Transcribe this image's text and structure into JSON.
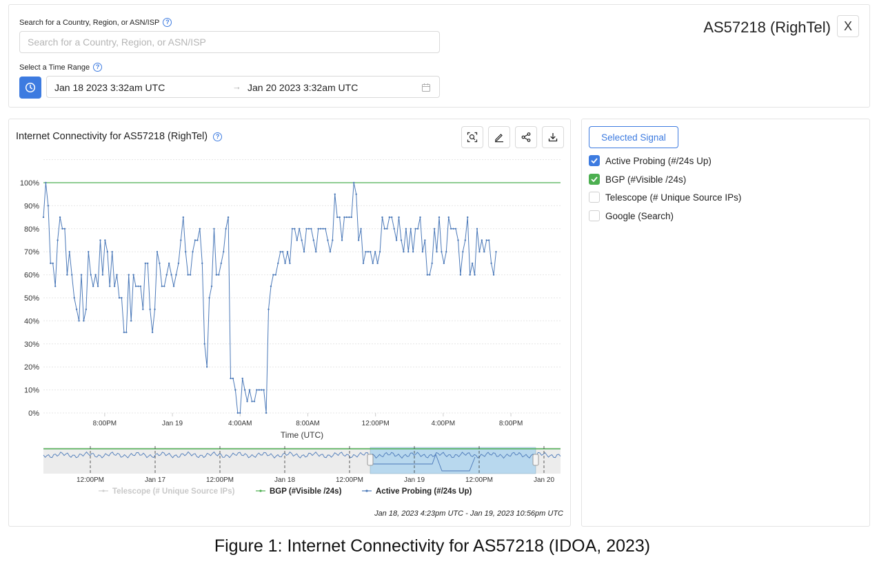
{
  "search": {
    "label": "Search for a Country, Region, or ASN/ISP",
    "placeholder": "Search for a Country, Region, or ASN/ISP"
  },
  "time_range": {
    "label": "Select a Time Range",
    "start": "Jan 18 2023 3:32am UTC",
    "end": "Jan 20 2023 3:32am UTC",
    "arrow": "→"
  },
  "entity_title": "AS57218 (RighTel)",
  "close_label": "X",
  "chart_panel": {
    "title": "Internet Connectivity for AS57218 (RighTel)",
    "caption": "Jan 18, 2023 4:23pm UTC - Jan 19, 2023 10:56pm UTC"
  },
  "signals": {
    "selected_button": "Selected Signal",
    "items": [
      {
        "label": "Active Probing (#/24s Up)",
        "checked": true,
        "color": "#3d7be0"
      },
      {
        "label": "BGP (#Visible /24s)",
        "checked": true,
        "color": "#4caf50"
      },
      {
        "label": "Telescope (# Unique Source IPs)",
        "checked": false,
        "color": ""
      },
      {
        "label": "Google (Search)",
        "checked": false,
        "color": ""
      }
    ]
  },
  "figure_caption": "Figure 1: Internet Connectivity for AS57218 (IDOA, 2023)",
  "chart_data": {
    "type": "line",
    "xlabel": "Time (UTC)",
    "ylabel": "",
    "ylim": [
      0,
      100
    ],
    "y_ticks": [
      "0%",
      "10%",
      "20%",
      "30%",
      "40%",
      "50%",
      "60%",
      "70%",
      "80%",
      "90%",
      "100%"
    ],
    "x_tick_labels": [
      "8:00PM",
      "Jan 19",
      "4:00AM",
      "8:00AM",
      "12:00PM",
      "4:00PM",
      "8:00PM"
    ],
    "x_tick_hours": [
      3.62,
      7.62,
      11.62,
      15.62,
      19.62,
      23.62,
      27.62
    ],
    "x_range_hours": [
      0,
      30.55
    ],
    "grid": true,
    "legend": "bottom",
    "series": [
      {
        "name": "BGP (#Visible /24s)",
        "color": "#4caf50",
        "points": [
          [
            0,
            100
          ],
          [
            30.55,
            100
          ]
        ]
      },
      {
        "name": "Active Probing (#/24s Up)",
        "color": "#4a78b8",
        "points": [
          [
            0.0,
            85
          ],
          [
            0.14,
            100
          ],
          [
            0.28,
            90
          ],
          [
            0.42,
            65
          ],
          [
            0.56,
            65
          ],
          [
            0.7,
            55
          ],
          [
            0.84,
            75
          ],
          [
            0.98,
            85
          ],
          [
            1.12,
            80
          ],
          [
            1.26,
            80
          ],
          [
            1.4,
            60
          ],
          [
            1.54,
            70
          ],
          [
            1.68,
            60
          ],
          [
            1.82,
            50
          ],
          [
            1.96,
            45
          ],
          [
            2.1,
            40
          ],
          [
            2.24,
            60
          ],
          [
            2.38,
            40
          ],
          [
            2.52,
            45
          ],
          [
            2.66,
            70
          ],
          [
            2.8,
            60
          ],
          [
            2.94,
            55
          ],
          [
            3.08,
            60
          ],
          [
            3.22,
            55
          ],
          [
            3.36,
            75
          ],
          [
            3.5,
            60
          ],
          [
            3.64,
            75
          ],
          [
            3.78,
            70
          ],
          [
            3.92,
            55
          ],
          [
            4.06,
            70
          ],
          [
            4.2,
            55
          ],
          [
            4.34,
            60
          ],
          [
            4.48,
            50
          ],
          [
            4.62,
            50
          ],
          [
            4.76,
            35
          ],
          [
            4.9,
            35
          ],
          [
            5.04,
            60
          ],
          [
            5.18,
            40
          ],
          [
            5.32,
            60
          ],
          [
            5.46,
            55
          ],
          [
            5.6,
            55
          ],
          [
            5.74,
            55
          ],
          [
            5.88,
            45
          ],
          [
            6.02,
            65
          ],
          [
            6.16,
            65
          ],
          [
            6.3,
            45
          ],
          [
            6.44,
            35
          ],
          [
            6.58,
            45
          ],
          [
            6.72,
            70
          ],
          [
            6.86,
            65
          ],
          [
            7.0,
            55
          ],
          [
            7.14,
            55
          ],
          [
            7.28,
            60
          ],
          [
            7.42,
            65
          ],
          [
            7.56,
            60
          ],
          [
            7.7,
            55
          ],
          [
            7.84,
            60
          ],
          [
            7.98,
            65
          ],
          [
            8.12,
            75
          ],
          [
            8.26,
            85
          ],
          [
            8.4,
            70
          ],
          [
            8.54,
            60
          ],
          [
            8.68,
            60
          ],
          [
            8.82,
            70
          ],
          [
            8.96,
            75
          ],
          [
            9.1,
            75
          ],
          [
            9.24,
            80
          ],
          [
            9.38,
            65
          ],
          [
            9.52,
            30
          ],
          [
            9.66,
            20
          ],
          [
            9.8,
            50
          ],
          [
            9.94,
            55
          ],
          [
            10.08,
            80
          ],
          [
            10.22,
            60
          ],
          [
            10.36,
            60
          ],
          [
            10.5,
            65
          ],
          [
            10.64,
            70
          ],
          [
            10.78,
            80
          ],
          [
            10.92,
            85
          ],
          [
            11.06,
            15
          ],
          [
            11.2,
            15
          ],
          [
            11.34,
            10
          ],
          [
            11.48,
            0
          ],
          [
            11.62,
            0
          ],
          [
            11.76,
            15
          ],
          [
            11.9,
            10
          ],
          [
            12.04,
            5
          ],
          [
            12.18,
            10
          ],
          [
            12.32,
            5
          ],
          [
            12.46,
            5
          ],
          [
            12.6,
            10
          ],
          [
            12.74,
            10
          ],
          [
            12.88,
            10
          ],
          [
            13.02,
            10
          ],
          [
            13.16,
            0
          ],
          [
            13.3,
            45
          ],
          [
            13.44,
            55
          ],
          [
            13.58,
            60
          ],
          [
            13.72,
            60
          ],
          [
            13.86,
            65
          ],
          [
            14.0,
            70
          ],
          [
            14.14,
            70
          ],
          [
            14.28,
            65
          ],
          [
            14.42,
            70
          ],
          [
            14.56,
            65
          ],
          [
            14.7,
            80
          ],
          [
            14.84,
            80
          ],
          [
            14.98,
            75
          ],
          [
            15.12,
            80
          ],
          [
            15.26,
            75
          ],
          [
            15.4,
            70
          ],
          [
            15.54,
            80
          ],
          [
            15.68,
            80
          ],
          [
            15.82,
            80
          ],
          [
            15.96,
            75
          ],
          [
            16.1,
            70
          ],
          [
            16.24,
            80
          ],
          [
            16.38,
            80
          ],
          [
            16.52,
            80
          ],
          [
            16.66,
            80
          ],
          [
            16.8,
            75
          ],
          [
            16.94,
            70
          ],
          [
            17.08,
            75
          ],
          [
            17.22,
            95
          ],
          [
            17.36,
            85
          ],
          [
            17.5,
            85
          ],
          [
            17.64,
            75
          ],
          [
            17.78,
            85
          ],
          [
            17.92,
            85
          ],
          [
            18.06,
            85
          ],
          [
            18.2,
            85
          ],
          [
            18.34,
            100
          ],
          [
            18.48,
            95
          ],
          [
            18.62,
            75
          ],
          [
            18.76,
            80
          ],
          [
            18.9,
            65
          ],
          [
            19.04,
            70
          ],
          [
            19.18,
            70
          ],
          [
            19.32,
            70
          ],
          [
            19.46,
            65
          ],
          [
            19.6,
            70
          ],
          [
            19.74,
            65
          ],
          [
            19.88,
            70
          ],
          [
            20.02,
            85
          ],
          [
            20.16,
            80
          ],
          [
            20.3,
            80
          ],
          [
            20.44,
            85
          ],
          [
            20.58,
            85
          ],
          [
            20.72,
            80
          ],
          [
            20.86,
            75
          ],
          [
            21.0,
            85
          ],
          [
            21.14,
            75
          ],
          [
            21.28,
            70
          ],
          [
            21.42,
            80
          ],
          [
            21.56,
            70
          ],
          [
            21.7,
            80
          ],
          [
            21.84,
            70
          ],
          [
            21.98,
            80
          ],
          [
            22.12,
            80
          ],
          [
            22.26,
            85
          ],
          [
            22.4,
            70
          ],
          [
            22.54,
            75
          ],
          [
            22.68,
            60
          ],
          [
            22.82,
            60
          ],
          [
            22.96,
            65
          ],
          [
            23.1,
            80
          ],
          [
            23.24,
            70
          ],
          [
            23.38,
            85
          ],
          [
            23.52,
            70
          ],
          [
            23.66,
            65
          ],
          [
            23.8,
            70
          ],
          [
            23.94,
            85
          ],
          [
            24.08,
            80
          ],
          [
            24.22,
            80
          ],
          [
            24.36,
            80
          ],
          [
            24.5,
            75
          ],
          [
            24.64,
            60
          ],
          [
            24.78,
            70
          ],
          [
            24.92,
            75
          ],
          [
            25.06,
            85
          ],
          [
            25.2,
            60
          ],
          [
            25.34,
            65
          ],
          [
            25.48,
            60
          ],
          [
            25.62,
            80
          ],
          [
            25.76,
            70
          ],
          [
            25.9,
            75
          ],
          [
            26.04,
            70
          ],
          [
            26.18,
            75
          ],
          [
            26.32,
            75
          ],
          [
            26.46,
            65
          ],
          [
            26.6,
            60
          ],
          [
            26.74,
            70
          ]
        ]
      }
    ],
    "navigator": {
      "x_tick_labels": [
        "12:00PM",
        "Jan 17",
        "12:00PM",
        "Jan 18",
        "12:00PM",
        "Jan 19",
        "12:00PM",
        "Jan 20"
      ],
      "selected_range": "Jan 18, 2023 4:23pm UTC - Jan 19, 2023 10:56pm UTC"
    },
    "legend_entries": [
      {
        "label": "Telescope (# Unique Source IPs)",
        "color": "#cccccc",
        "active": false
      },
      {
        "label": "BGP (#Visible /24s)",
        "color": "#4caf50",
        "active": true
      },
      {
        "label": "Active Probing (#/24s Up)",
        "color": "#4a78b8",
        "active": true
      }
    ]
  }
}
